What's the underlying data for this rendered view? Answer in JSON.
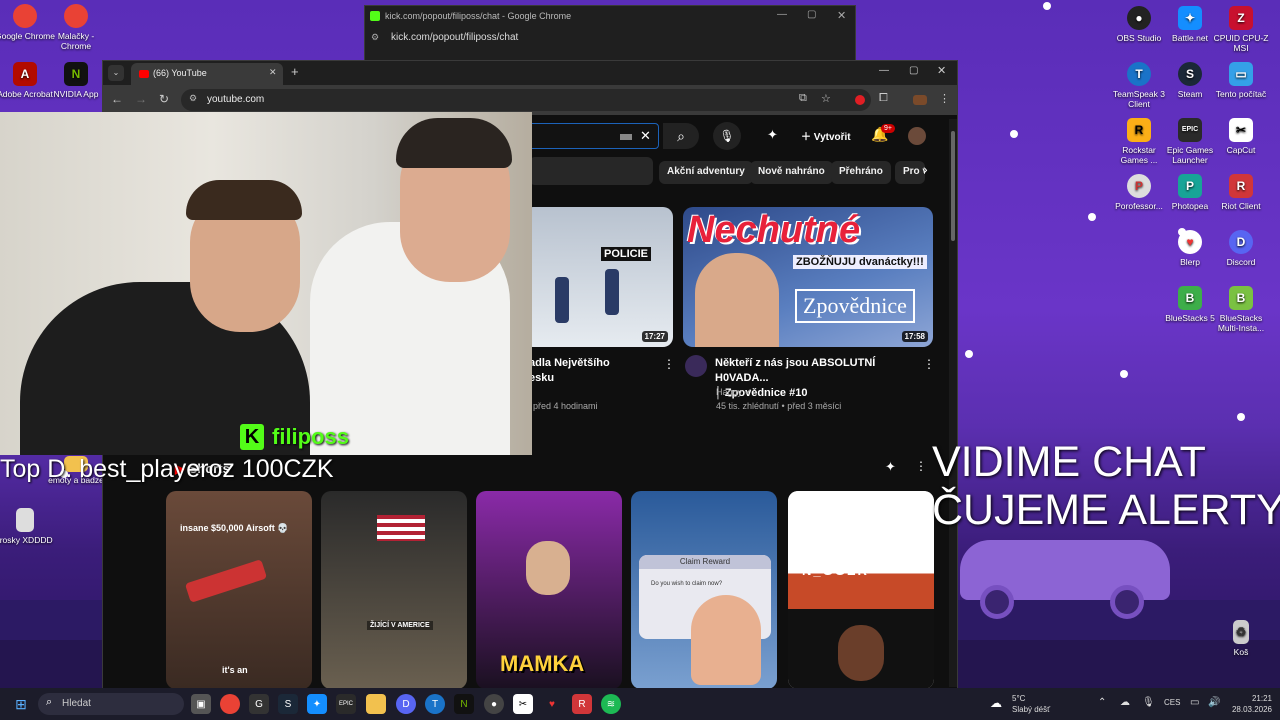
{
  "desktop": {
    "left_icons": [
      {
        "label": "Google Chrome",
        "color": "#e94235"
      },
      {
        "label": "Malačky - Chrome",
        "color": "#e94235"
      },
      {
        "label": "Adobe Acrobat",
        "color": "#b30b00"
      },
      {
        "label": "NVIDIA App",
        "color": "#76b900"
      },
      {
        "label": "emoty a badze",
        "color": "#f2c14e"
      },
      {
        "label": "trosky XDDDD",
        "color": "#999999"
      }
    ],
    "right_icons": [
      {
        "label": "OBS Studio",
        "color": "#222222"
      },
      {
        "label": "Battle.net",
        "color": "#148eff"
      },
      {
        "label": "CPUID CPU-Z MSI",
        "color": "#c8102e"
      },
      {
        "label": "TeamSpeak 3 Client",
        "color": "#1a73c8"
      },
      {
        "label": "Steam",
        "color": "#1b2838"
      },
      {
        "label": "Tento počítač",
        "color": "#34a0e8"
      },
      {
        "label": "Rockstar Games ...",
        "color": "#fcaf17"
      },
      {
        "label": "Epic Games Launcher",
        "color": "#2a2a2a"
      },
      {
        "label": "CapCut",
        "color": "#111111"
      },
      {
        "label": "Porofessor...",
        "color": "#dddddd"
      },
      {
        "label": "Photopea",
        "color": "#18a497"
      },
      {
        "label": "Riot Client",
        "color": "#d13639"
      },
      {
        "label": "Blerp",
        "color": "#ffffff"
      },
      {
        "label": "Discord",
        "color": "#5865f2"
      },
      {
        "label": "BlueStacks 5",
        "color": "#3dae49"
      },
      {
        "label": "BlueStacks Multi-Insta...",
        "color": "#7ac142"
      },
      {
        "label": "Koš",
        "color": "#cccccc"
      }
    ]
  },
  "kick_window": {
    "title": "kick.com/popout/filiposs/chat - Google Chrome",
    "url": "kick.com/popout/filiposs/chat"
  },
  "chrome": {
    "tab_title": "(66) YouTube",
    "url": "youtube.com",
    "new_tab": "+"
  },
  "youtube": {
    "create_label": "Vytvořit",
    "notif_count": "9+",
    "chips": [
      "Akční adventury",
      "Nově nahráno",
      "Přehráno",
      "Pro v"
    ],
    "videos": [
      {
        "title_line1": "adla Největšího",
        "title_line2": "esku",
        "meta": "před 4 hodinami",
        "duration": "17:27",
        "thumb_text": "POLICIE"
      },
      {
        "title_line1": "Někteří z nás jsou ABSOLUTNÍ H0VADA...",
        "title_line2": "│ Zpovědnice #10",
        "channel": "Haggy",
        "meta": "45 tis. zhlédnutí • před 3 měsíci",
        "duration": "17:58",
        "thumb_big": "Nechutné",
        "thumb_sub": "ZBOŽŇUJU dvanáctky!!!",
        "thumb_word": "Zpovědnice"
      }
    ],
    "shorts_label": "Shorts",
    "shorts": [
      {
        "top": "insane $50,000 Airsoft 💀",
        "bottom": "it's an"
      },
      {
        "caption": "ŽIJÍCÍ V AMERICE"
      },
      {
        "caption": "MAMKA"
      },
      {
        "caption": "Claim Reward",
        "sub": "Do you wish to claim now?"
      },
      {
        "caption": "N_GGER"
      }
    ]
  },
  "overlay": {
    "streamer": "filiposs",
    "top_donor": "Top D. best_playeroz 100CZK",
    "line1": "VIDIME CHAT",
    "line2": "ČUJEME ALERTY"
  },
  "taskbar": {
    "search": "Hledat",
    "weather_temp": "5°C",
    "weather_desc": "Slabý déšť",
    "lang": "CES",
    "time": "21:21",
    "date": "28.03.2026"
  }
}
